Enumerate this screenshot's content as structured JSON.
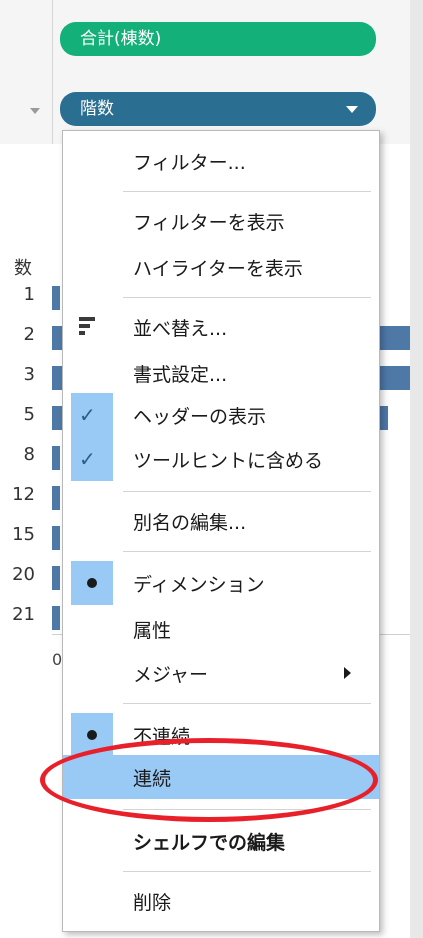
{
  "shelves": {
    "columns_pill": "合計(棟数)",
    "rows_pill": "階数"
  },
  "view": {
    "header": "数",
    "rows": [
      {
        "label": "1",
        "value": 1
      },
      {
        "label": "2",
        "value": 1
      },
      {
        "label": "3",
        "value": 1
      },
      {
        "label": "5",
        "value": 1
      },
      {
        "label": "8",
        "value": 1
      },
      {
        "label": "12",
        "value": 1
      },
      {
        "label": "15",
        "value": 1
      },
      {
        "label": "20",
        "value": 1
      },
      {
        "label": "21",
        "value": 1
      }
    ],
    "axis_zero": "0"
  },
  "menu": {
    "filter": "フィルター...",
    "show_filter": "フィルターを表示",
    "show_highlighter": "ハイライターを表示",
    "sort": "並べ替え...",
    "format": "書式設定...",
    "show_header": "ヘッダーの表示",
    "include_tooltip": "ツールヒントに含める",
    "edit_alias": "別名の編集...",
    "dimension": "ディメンション",
    "attribute": "属性",
    "measure": "メジャー",
    "discrete": "不連続",
    "continuous": "連続",
    "edit_in_shelf": "シェルフでの編集",
    "remove": "削除"
  },
  "colors": {
    "measure_pill": "#13b07a",
    "dimension_pill": "#2a6f91",
    "menu_highlight": "#99c9f5",
    "annotation_ring": "#e8202a"
  }
}
